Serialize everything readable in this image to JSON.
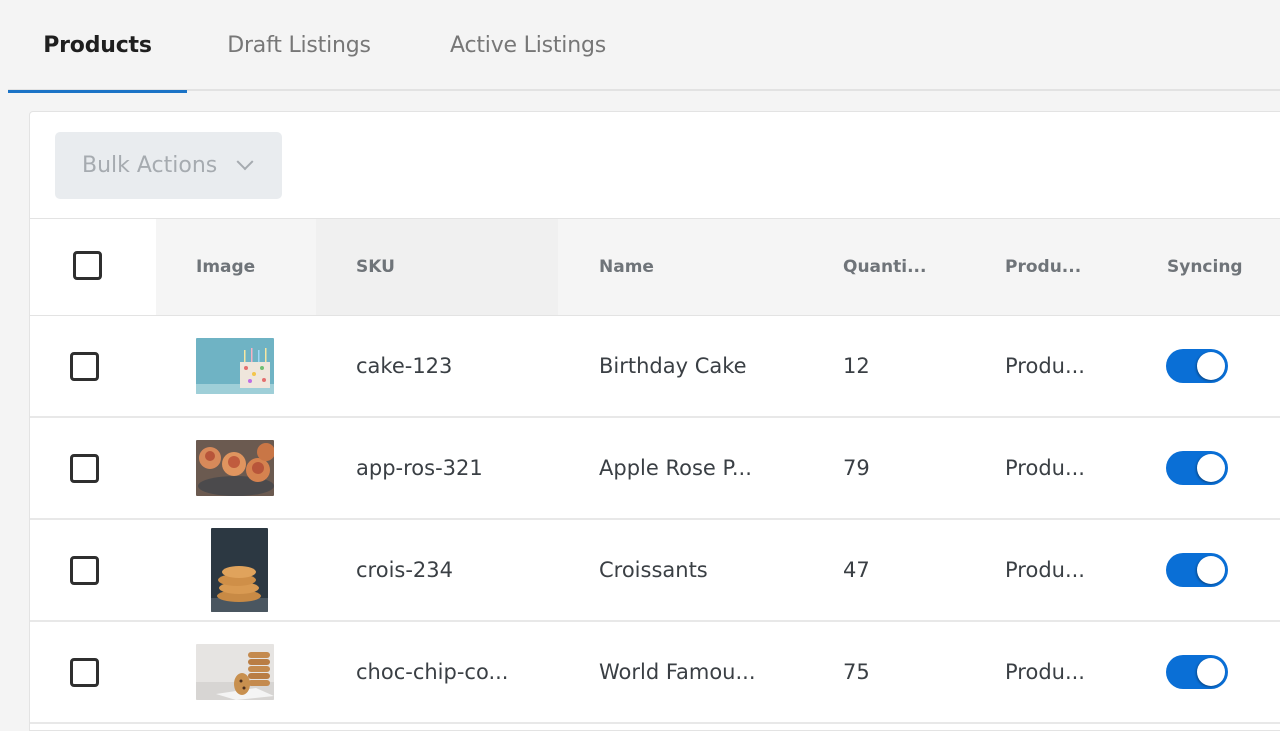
{
  "tabs": [
    {
      "label": "Products",
      "active": true
    },
    {
      "label": "Draft Listings",
      "active": false
    },
    {
      "label": "Active Listings",
      "active": false
    }
  ],
  "toolbar": {
    "bulk_actions_label": "Bulk Actions",
    "bulk_actions_icon": "chevron-down-icon"
  },
  "table": {
    "columns": [
      "Image",
      "SKU",
      "Name",
      "Quanti...",
      "Produ...",
      "Syncing"
    ],
    "rows": [
      {
        "image": "birthday-cake-photo",
        "sku": "cake-123",
        "name": "Birthday Cake",
        "quantity": "12",
        "product": "Produ...",
        "syncing": true,
        "selected": false
      },
      {
        "image": "apple-rose-pastry-photo",
        "sku": "app-ros-321",
        "name": "Apple Rose P...",
        "quantity": "79",
        "product": "Produ...",
        "syncing": true,
        "selected": false
      },
      {
        "image": "croissants-photo",
        "sku": "crois-234",
        "name": "Croissants",
        "quantity": "47",
        "product": "Produ...",
        "syncing": true,
        "selected": false
      },
      {
        "image": "chocolate-chip-cookies-photo",
        "sku": "choc-chip-co...",
        "name": "World Famou...",
        "quantity": "75",
        "product": "Produ...",
        "syncing": true,
        "selected": false
      }
    ]
  },
  "colors": {
    "accent": "#1b73c6",
    "toggle_on": "#0a6fd6"
  }
}
